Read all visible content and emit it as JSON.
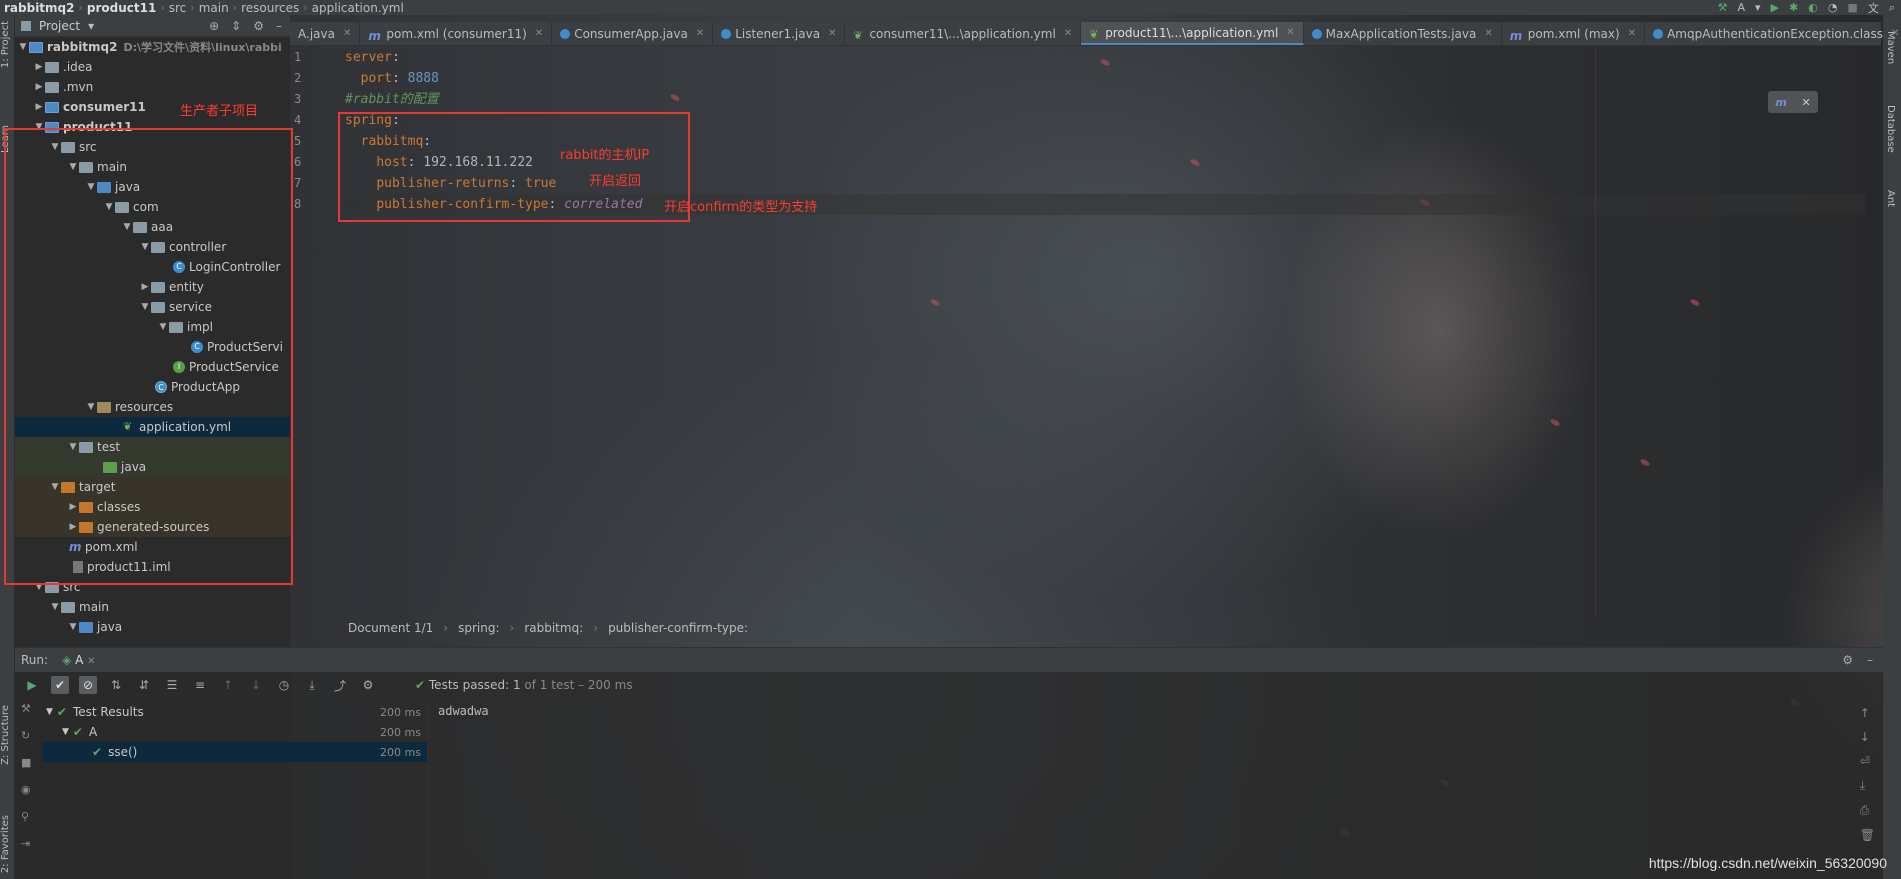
{
  "navbar": {
    "crumbs": [
      "rabbitmq2",
      "product11",
      "src",
      "main",
      "resources",
      "application.yml"
    ],
    "run_config": "A"
  },
  "left_stripe": {
    "project": "1: Project",
    "learn": "Learn",
    "structure": "Z: Structure",
    "favorites": "2: Favorites"
  },
  "right_stripe": {
    "maven": "Maven",
    "database": "Database",
    "ant": "Ant"
  },
  "project_panel": {
    "title": "Project",
    "tree": [
      {
        "label": "rabbitmq2",
        "hint": "D:\\学习文件\\资料\\linux\\rabbi"
      },
      {
        "label": ".idea"
      },
      {
        "label": ".mvn"
      },
      {
        "label": "consumer11"
      },
      {
        "label": "product11"
      },
      {
        "label": "src"
      },
      {
        "label": "main"
      },
      {
        "label": "java"
      },
      {
        "label": "com"
      },
      {
        "label": "aaa"
      },
      {
        "label": "controller"
      },
      {
        "label": "LoginController"
      },
      {
        "label": "entity"
      },
      {
        "label": "service"
      },
      {
        "label": "impl"
      },
      {
        "label": "ProductServi"
      },
      {
        "label": "ProductService"
      },
      {
        "label": "ProductApp"
      },
      {
        "label": "resources"
      },
      {
        "label": "application.yml"
      },
      {
        "label": "test"
      },
      {
        "label": "java"
      },
      {
        "label": "target"
      },
      {
        "label": "classes"
      },
      {
        "label": "generated-sources"
      },
      {
        "label": "pom.xml"
      },
      {
        "label": "product11.iml"
      },
      {
        "label": "src"
      },
      {
        "label": "main"
      },
      {
        "label": "java"
      }
    ]
  },
  "editor_tabs": [
    "A.java",
    "pom.xml (consumer11)",
    "ConsumerApp.java",
    "Listener1.java",
    "consumer11\\...\\application.yml",
    "product11\\...\\application.yml",
    "MaxApplicationTests.java",
    "pom.xml (max)",
    "AmqpAuthenticationException.class"
  ],
  "code": {
    "line_numbers": [
      "1",
      "2",
      "3",
      "4",
      "5",
      "6",
      "7",
      "8"
    ],
    "l1_key": "server",
    "l2_key": "port",
    "l2_val": "8888",
    "l3_comment": "#rabbit的配置",
    "l4_key": "spring",
    "l5_key": "rabbitmq",
    "l6_key": "host",
    "l6_val": "192.168.11.222",
    "l7_key": "publisher-returns",
    "l7_val": "true",
    "l8_key": "publisher-confirm-type",
    "l8_val": "correlated"
  },
  "annotations": {
    "producer_project": "生产者子项目",
    "rabbit_host": "rabbit的主机IP",
    "enable_return": "开启返回",
    "confirm_type": "开启confirm的类型为支持"
  },
  "editor_breadcrumb": [
    "Document 1/1",
    "spring:",
    "rabbitmq:",
    "publisher-confirm-type:"
  ],
  "run_panel": {
    "label": "Run:",
    "tab": "A",
    "status_prefix": "Tests passed:",
    "status_count": "1",
    "status_suffix": "of 1 test – 200 ms",
    "results": [
      {
        "label": "Test Results",
        "time": "200 ms"
      },
      {
        "label": "A",
        "time": "200 ms"
      },
      {
        "label": "sse()",
        "time": "200 ms"
      }
    ],
    "console_output": "adwadwa"
  },
  "watermark": "https://blog.csdn.net/weixin_56320090"
}
